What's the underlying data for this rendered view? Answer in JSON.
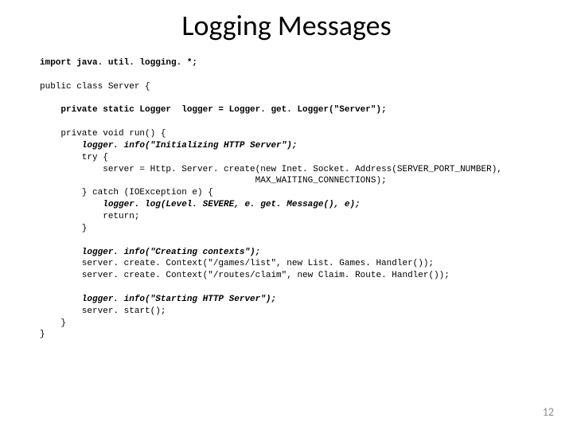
{
  "title": "Logging Messages",
  "page_number": "12",
  "code": {
    "l01": "import java. util. logging. *;",
    "l02": "public class Server {",
    "l03": "    private static Logger  logger = Logger. get. Logger(\"Server\");",
    "l04": "    private void run() {",
    "l05": "        logger. info(\"Initializing HTTP Server\");",
    "l06": "        try {",
    "l07": "            server = Http. Server. create(new Inet. Socket. Address(SERVER_PORT_NUMBER),",
    "l08": "                                         MAX_WAITING_CONNECTIONS);",
    "l09": "        } catch (IOException e) {",
    "l10": "            logger. log(Level. SEVERE, e. get. Message(), e);",
    "l11": "            return;",
    "l12": "        }",
    "l13": "        logger. info(\"Creating contexts\");",
    "l14": "        server. create. Context(\"/games/list\", new List. Games. Handler());",
    "l15": "        server. create. Context(\"/routes/claim\", new Claim. Route. Handler());",
    "l16": "        logger. info(\"Starting HTTP Server\");",
    "l17": "        server. start();",
    "l18": "    }",
    "l19": "}"
  }
}
